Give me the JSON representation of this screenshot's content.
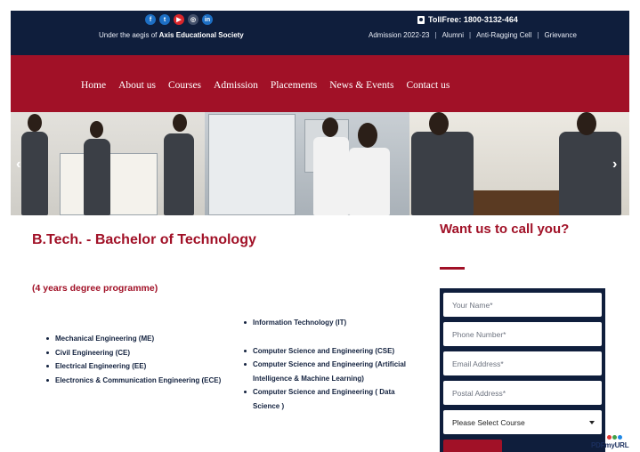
{
  "topbar": {
    "social_icons": [
      "facebook-icon",
      "twitter-icon",
      "youtube-icon",
      "instagram-icon",
      "linkedin-icon"
    ],
    "social_glyphs": [
      "f",
      "t",
      "▶",
      "◎",
      "in"
    ],
    "tollfree": "TollFree: 1800-3132-464",
    "aegis_prefix": "Under the aegis of",
    "aegis_org": "Axis Educational Society",
    "links": [
      "Admission 2022-23",
      "Alumni",
      "Anti-Ragging Cell",
      "Grievance"
    ],
    "separator": "|"
  },
  "nav": {
    "items": [
      "Home",
      "About us",
      "Courses",
      "Admission",
      "Placements",
      "News & Events",
      "Contact us"
    ]
  },
  "banner": {
    "prev": "‹",
    "next": "›"
  },
  "content": {
    "title": "B.Tech. - Bachelor of Technology",
    "subtitle": "(4 years degree programme)",
    "left_list": [
      "Mechanical Engineering (ME)",
      "Civil Engineering (CE)",
      "Electrical Engineering (EE)",
      "Electronics & Communication Engineering (ECE)"
    ],
    "right_list": [
      "Information Technology (IT)",
      "Computer Science and Engineering (CSE)",
      "Computer Science and Engineering (Artificial Intelligence & Machine Learning)",
      "Computer Science and Engineering ( Data Science )"
    ]
  },
  "form": {
    "title": "Want us to call you?",
    "name_placeholder": "Your Name*",
    "phone_placeholder": "Phone Number*",
    "email_placeholder": "Email Address*",
    "postal_placeholder": "Postal Address*",
    "course_selected": "Please Select Course"
  },
  "watermark": {
    "prefix": "PDFmy",
    "suffix": "URL"
  },
  "colors": {
    "navy": "#0f1e3c",
    "crimson": "#a11127",
    "social_blue": "#1d6fc4"
  }
}
